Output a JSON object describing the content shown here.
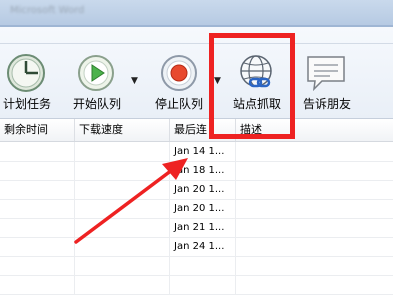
{
  "window": {
    "title": "Microsoft Word"
  },
  "toolbar": {
    "buttons": [
      {
        "label": "计划任务",
        "icon": "clock-icon"
      },
      {
        "label": "开始队列",
        "icon": "play-icon"
      },
      {
        "label": "停止队列",
        "icon": "record-stop-icon"
      },
      {
        "label": "站点抓取",
        "icon": "globe-link-icon"
      },
      {
        "label": "告诉朋友",
        "icon": "speech-bubble-icon"
      }
    ]
  },
  "table": {
    "columns": [
      "剩余时间",
      "下载速度",
      "最后连",
      "描述"
    ],
    "rows": [
      {
        "last_connected": "Jan 14 1..."
      },
      {
        "last_connected": "Jan 18 1..."
      },
      {
        "last_connected": "Jan 20 1..."
      },
      {
        "last_connected": "Jan 20 1..."
      },
      {
        "last_connected": "Jan 21 1..."
      },
      {
        "last_connected": "Jan 24 1..."
      },
      {
        "last_connected": ""
      },
      {
        "last_connected": ""
      }
    ]
  },
  "annotation": {
    "color": "#ee2222"
  }
}
